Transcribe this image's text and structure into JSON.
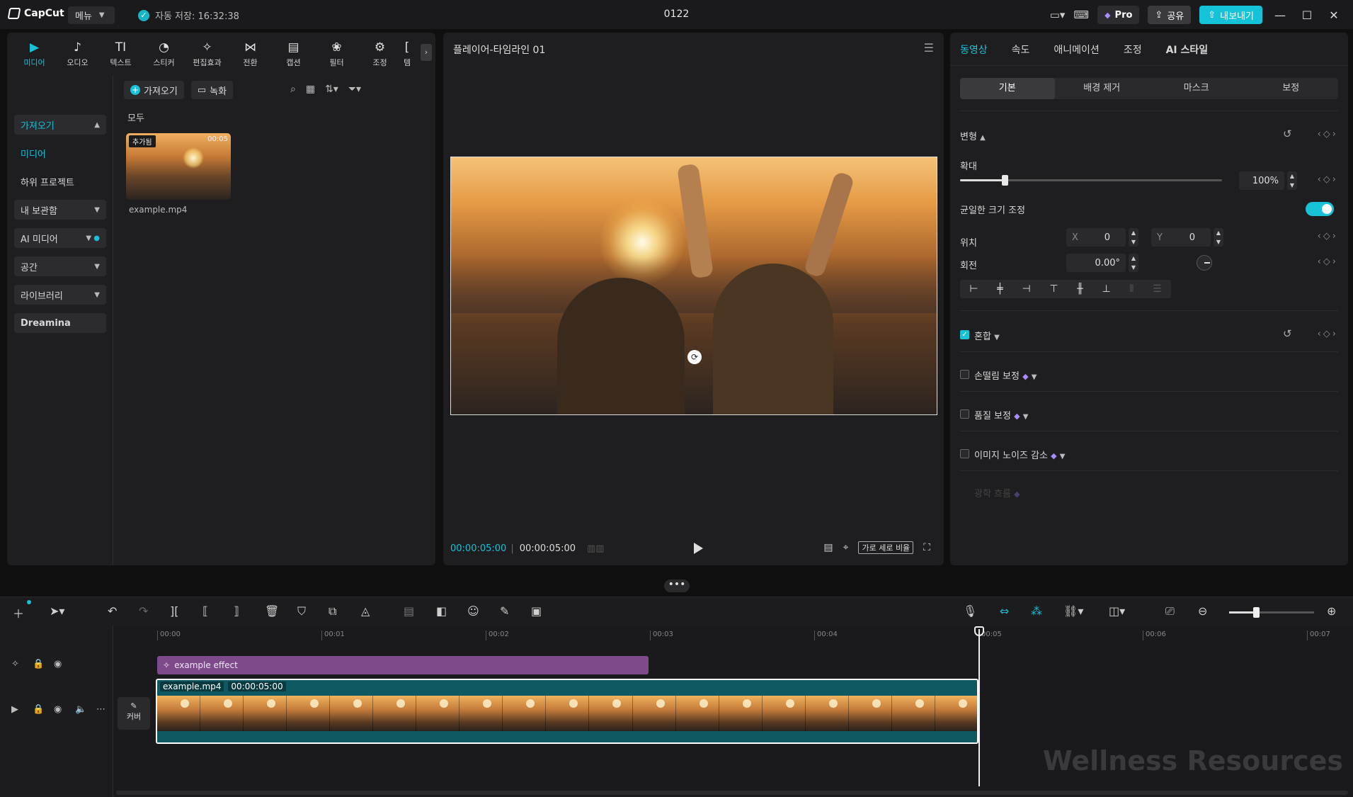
{
  "titlebar": {
    "logo": "CapCut",
    "menu": "메뉴",
    "autosave": "자동 저장: 16:32:38",
    "project": "0122",
    "pro": "Pro",
    "share": "공유",
    "export": "내보내기"
  },
  "tooltabs": [
    {
      "label": "미디어",
      "icon": "media-icon"
    },
    {
      "label": "오디오",
      "icon": "audio-icon"
    },
    {
      "label": "텍스트",
      "icon": "text-icon"
    },
    {
      "label": "스티커",
      "icon": "sticker-icon"
    },
    {
      "label": "편집효과",
      "icon": "effects-icon"
    },
    {
      "label": "전환",
      "icon": "transition-icon"
    },
    {
      "label": "캡션",
      "icon": "caption-icon"
    },
    {
      "label": "필터",
      "icon": "filter-icon"
    },
    {
      "label": "조정",
      "icon": "adjust-icon"
    },
    {
      "label": "템",
      "icon": "template-icon"
    }
  ],
  "sidebar": {
    "import": "가져오기",
    "media": "미디어",
    "sub_projects": "하위 프로젝트",
    "my_library": "내 보관함",
    "ai_media": "AI 미디어",
    "space": "공간",
    "library": "라이브러리",
    "dreamina": "Dreamina"
  },
  "media": {
    "import_btn": "가져오기",
    "record_btn": "녹화",
    "filter_all": "모두",
    "thumb_tag": "추가됨",
    "thumb_duration": "00:05",
    "file_name": "example.mp4"
  },
  "preview": {
    "title": "플레이어-타임라인 01",
    "time_current": "00:00:05:00",
    "time_total": "00:00:05:00",
    "ratio": "가로 세로 비율"
  },
  "inspector": {
    "tabs": [
      "동영상",
      "속도",
      "애니메이션",
      "조정",
      "AI 스타일"
    ],
    "subtabs": [
      "기본",
      "배경 제거",
      "마스크",
      "보정"
    ],
    "transform": "변형",
    "scale": "확대",
    "scale_value": "100%",
    "uniform_scale": "균일한 크기 조정",
    "position": "위치",
    "x_label": "X",
    "x_value": "0",
    "y_label": "Y",
    "y_value": "0",
    "rotation": "회전",
    "rotation_value": "0.00°",
    "blend": "혼합",
    "stabilize": "손떨림 보정",
    "quality": "품질 보정",
    "denoise": "이미지 노이즈 감소",
    "optical_flow": "광학 흐름",
    "scale_percent": 0.17
  },
  "timeline": {
    "ruler": [
      "00:00",
      "00:01",
      "00:02",
      "00:03",
      "00:04",
      "00:05",
      "00:06",
      "00:07"
    ],
    "effect_clip": "example effect",
    "video_clip_name": "example.mp4",
    "video_clip_duration": "00:00:05:00",
    "cover": "커버",
    "handle": "•••"
  },
  "watermark": "Wellness Resources",
  "colors": {
    "accent": "#17c1d6",
    "effect": "#7e4a8c",
    "clip": "#0f5a62"
  }
}
